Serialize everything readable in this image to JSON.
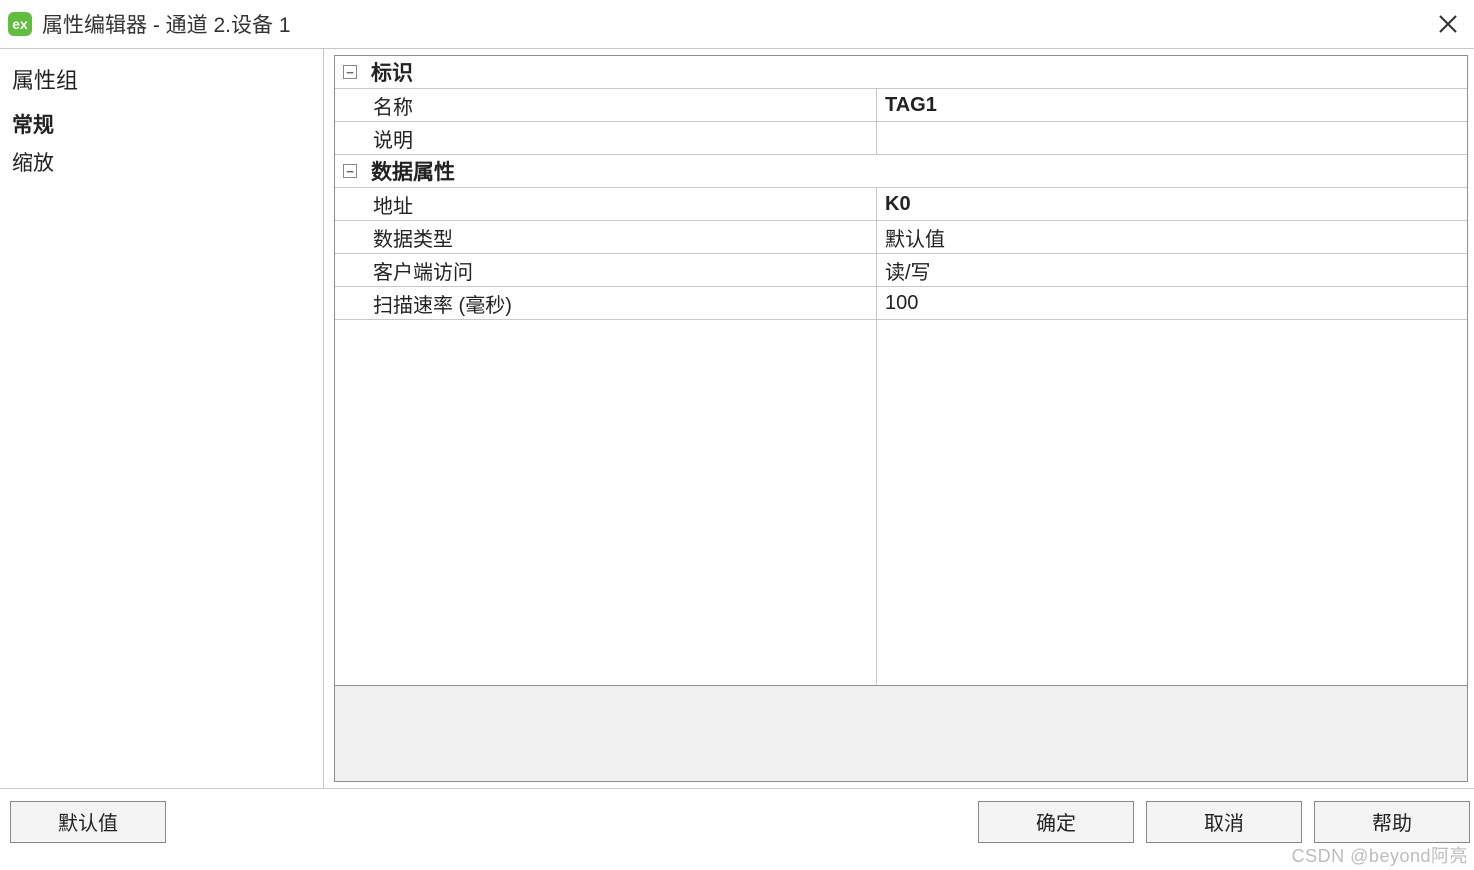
{
  "window": {
    "app_icon_text": "ex",
    "title": "属性编辑器 - 通道 2.设备 1"
  },
  "sidebar": {
    "heading": "属性组",
    "items": [
      {
        "label": "常规",
        "active": true
      },
      {
        "label": "缩放",
        "active": false
      }
    ]
  },
  "groups": [
    {
      "title": "标识",
      "rows": [
        {
          "label": "名称",
          "value": "TAG1",
          "bold": true
        },
        {
          "label": "说明",
          "value": "",
          "bold": false
        }
      ]
    },
    {
      "title": "数据属性",
      "rows": [
        {
          "label": "地址",
          "value": "K0",
          "bold": true
        },
        {
          "label": "数据类型",
          "value": "默认值",
          "bold": false
        },
        {
          "label": "客户端访问",
          "value": "读/写",
          "bold": false
        },
        {
          "label": "扫描速率 (毫秒)",
          "value": "100",
          "bold": false
        }
      ]
    }
  ],
  "buttons": {
    "defaults": "默认值",
    "ok": "确定",
    "cancel": "取消",
    "help": "帮助"
  },
  "watermark": "CSDN @beyond阿亮"
}
